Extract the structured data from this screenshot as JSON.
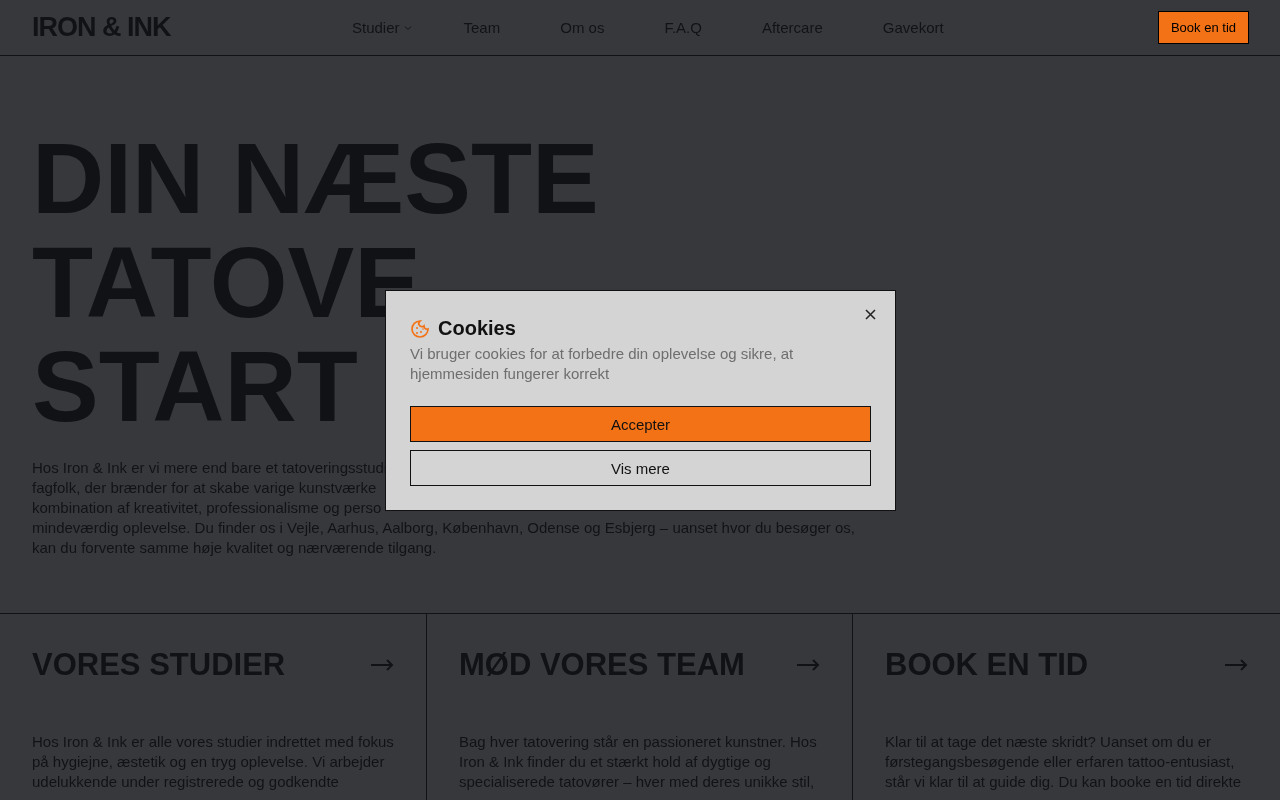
{
  "header": {
    "logo": "IRON & INK",
    "nav": [
      {
        "label": "Studier",
        "dropdown": true
      },
      {
        "label": "Team",
        "dropdown": false
      },
      {
        "label": "Om os",
        "dropdown": false
      },
      {
        "label": "F.A.Q",
        "dropdown": false
      },
      {
        "label": "Aftercare",
        "dropdown": false
      },
      {
        "label": "Gavekort",
        "dropdown": false
      }
    ],
    "cta": "Book en tid"
  },
  "hero": {
    "heading_lines": [
      "DIN NÆSTE",
      "TATOVE",
      "START"
    ],
    "paragraph_lines": [
      "Hos Iron & Ink er vi mere end bare et tatoveringsstudi",
      "fagfolk, der brænder for at skabe varige kunstværke",
      "kombination af kreativitet, professionalisme og perso",
      "mindeværdig oplevelse. Du finder os i Vejle, Aarhus, Aalborg, København, Odense og Esbjerg – uanset hvor du besøger os,",
      "kan du forvente samme høje kvalitet og nærværende tilgang."
    ]
  },
  "cards": [
    {
      "title": "VORES STUDIER",
      "lines": [
        "Hos Iron & Ink er alle vores studier indrettet med fokus",
        "på hygiejne, æstetik og en tryg oplevelse. Vi arbejder",
        "udelukkende under registrerede og godkendte"
      ]
    },
    {
      "title": "MØD VORES TEAM",
      "lines": [
        "Bag hver tatovering står en passioneret kunstner. Hos",
        "Iron & Ink finder du et stærkt hold af dygtige og",
        "specialiserede tatovører – hver med deres unikke stil,"
      ]
    },
    {
      "title": "BOOK EN TID",
      "lines": [
        "Klar til at tage det næste skridt? Uanset om du er",
        "førstegangsbesøgende eller erfaren tattoo-entusiast,",
        "står vi klar til at guide dig. Du kan booke en tid direkte"
      ]
    }
  ],
  "cookie_dialog": {
    "title": "Cookies",
    "text": "Vi bruger cookies for at forbedre din oplevelse og sikre, at hjemmesiden fungerer korrekt",
    "buttons": [
      {
        "label": "Accepter",
        "kind": "primary"
      },
      {
        "label": "Vis mere",
        "kind": "secondary"
      }
    ]
  }
}
